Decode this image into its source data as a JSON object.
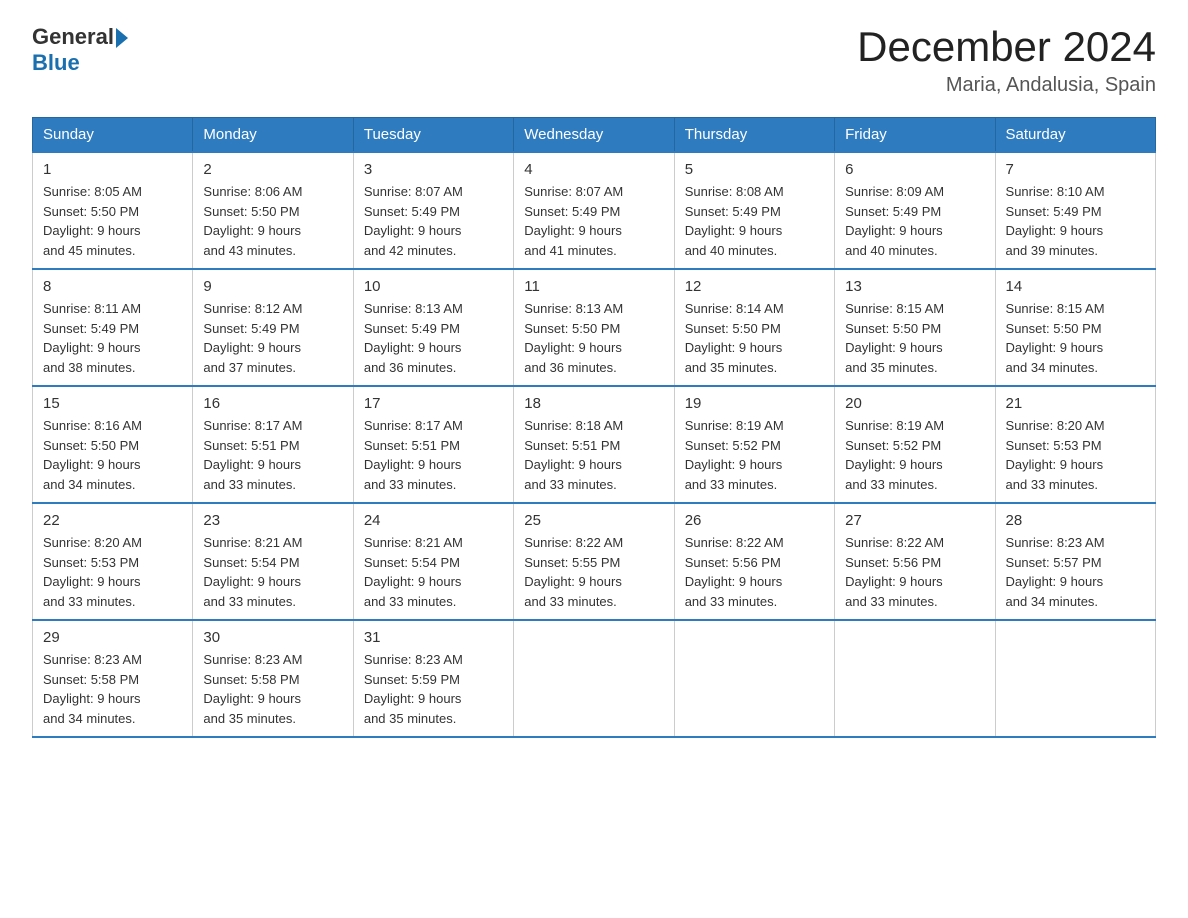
{
  "logo": {
    "general": "General",
    "blue": "Blue"
  },
  "title": {
    "month": "December 2024",
    "location": "Maria, Andalusia, Spain"
  },
  "days_of_week": [
    "Sunday",
    "Monday",
    "Tuesday",
    "Wednesday",
    "Thursday",
    "Friday",
    "Saturday"
  ],
  "weeks": [
    [
      {
        "day": "1",
        "sunrise": "8:05 AM",
        "sunset": "5:50 PM",
        "daylight": "9 hours and 45 minutes."
      },
      {
        "day": "2",
        "sunrise": "8:06 AM",
        "sunset": "5:50 PM",
        "daylight": "9 hours and 43 minutes."
      },
      {
        "day": "3",
        "sunrise": "8:07 AM",
        "sunset": "5:49 PM",
        "daylight": "9 hours and 42 minutes."
      },
      {
        "day": "4",
        "sunrise": "8:07 AM",
        "sunset": "5:49 PM",
        "daylight": "9 hours and 41 minutes."
      },
      {
        "day": "5",
        "sunrise": "8:08 AM",
        "sunset": "5:49 PM",
        "daylight": "9 hours and 40 minutes."
      },
      {
        "day": "6",
        "sunrise": "8:09 AM",
        "sunset": "5:49 PM",
        "daylight": "9 hours and 40 minutes."
      },
      {
        "day": "7",
        "sunrise": "8:10 AM",
        "sunset": "5:49 PM",
        "daylight": "9 hours and 39 minutes."
      }
    ],
    [
      {
        "day": "8",
        "sunrise": "8:11 AM",
        "sunset": "5:49 PM",
        "daylight": "9 hours and 38 minutes."
      },
      {
        "day": "9",
        "sunrise": "8:12 AM",
        "sunset": "5:49 PM",
        "daylight": "9 hours and 37 minutes."
      },
      {
        "day": "10",
        "sunrise": "8:13 AM",
        "sunset": "5:49 PM",
        "daylight": "9 hours and 36 minutes."
      },
      {
        "day": "11",
        "sunrise": "8:13 AM",
        "sunset": "5:50 PM",
        "daylight": "9 hours and 36 minutes."
      },
      {
        "day": "12",
        "sunrise": "8:14 AM",
        "sunset": "5:50 PM",
        "daylight": "9 hours and 35 minutes."
      },
      {
        "day": "13",
        "sunrise": "8:15 AM",
        "sunset": "5:50 PM",
        "daylight": "9 hours and 35 minutes."
      },
      {
        "day": "14",
        "sunrise": "8:15 AM",
        "sunset": "5:50 PM",
        "daylight": "9 hours and 34 minutes."
      }
    ],
    [
      {
        "day": "15",
        "sunrise": "8:16 AM",
        "sunset": "5:50 PM",
        "daylight": "9 hours and 34 minutes."
      },
      {
        "day": "16",
        "sunrise": "8:17 AM",
        "sunset": "5:51 PM",
        "daylight": "9 hours and 33 minutes."
      },
      {
        "day": "17",
        "sunrise": "8:17 AM",
        "sunset": "5:51 PM",
        "daylight": "9 hours and 33 minutes."
      },
      {
        "day": "18",
        "sunrise": "8:18 AM",
        "sunset": "5:51 PM",
        "daylight": "9 hours and 33 minutes."
      },
      {
        "day": "19",
        "sunrise": "8:19 AM",
        "sunset": "5:52 PM",
        "daylight": "9 hours and 33 minutes."
      },
      {
        "day": "20",
        "sunrise": "8:19 AM",
        "sunset": "5:52 PM",
        "daylight": "9 hours and 33 minutes."
      },
      {
        "day": "21",
        "sunrise": "8:20 AM",
        "sunset": "5:53 PM",
        "daylight": "9 hours and 33 minutes."
      }
    ],
    [
      {
        "day": "22",
        "sunrise": "8:20 AM",
        "sunset": "5:53 PM",
        "daylight": "9 hours and 33 minutes."
      },
      {
        "day": "23",
        "sunrise": "8:21 AM",
        "sunset": "5:54 PM",
        "daylight": "9 hours and 33 minutes."
      },
      {
        "day": "24",
        "sunrise": "8:21 AM",
        "sunset": "5:54 PM",
        "daylight": "9 hours and 33 minutes."
      },
      {
        "day": "25",
        "sunrise": "8:22 AM",
        "sunset": "5:55 PM",
        "daylight": "9 hours and 33 minutes."
      },
      {
        "day": "26",
        "sunrise": "8:22 AM",
        "sunset": "5:56 PM",
        "daylight": "9 hours and 33 minutes."
      },
      {
        "day": "27",
        "sunrise": "8:22 AM",
        "sunset": "5:56 PM",
        "daylight": "9 hours and 33 minutes."
      },
      {
        "day": "28",
        "sunrise": "8:23 AM",
        "sunset": "5:57 PM",
        "daylight": "9 hours and 34 minutes."
      }
    ],
    [
      {
        "day": "29",
        "sunrise": "8:23 AM",
        "sunset": "5:58 PM",
        "daylight": "9 hours and 34 minutes."
      },
      {
        "day": "30",
        "sunrise": "8:23 AM",
        "sunset": "5:58 PM",
        "daylight": "9 hours and 35 minutes."
      },
      {
        "day": "31",
        "sunrise": "8:23 AM",
        "sunset": "5:59 PM",
        "daylight": "9 hours and 35 minutes."
      },
      null,
      null,
      null,
      null
    ]
  ],
  "labels": {
    "sunrise": "Sunrise:",
    "sunset": "Sunset:",
    "daylight": "Daylight:"
  }
}
